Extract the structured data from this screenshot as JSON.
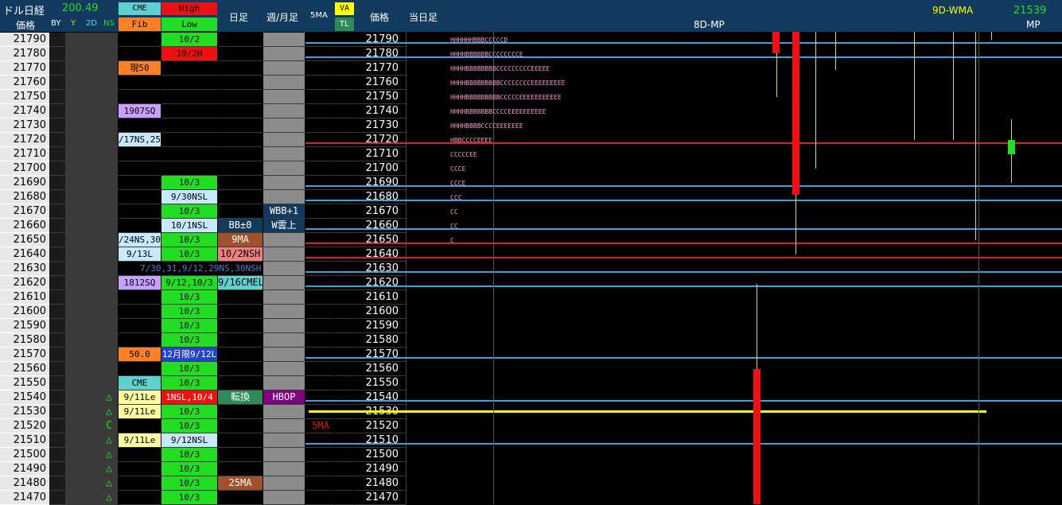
{
  "header": {
    "title": "ドル日経",
    "title_value": "200.49",
    "price_label": "価格",
    "flags": [
      "BY",
      "Y",
      "2D",
      "NS"
    ],
    "cme_label": "CME",
    "fib_label": "Fib",
    "high_label": "High",
    "low_label": "Low",
    "daily_label": "日足",
    "weekly_label": "週/月足",
    "ma5_label": "5MA",
    "va_label": "VA",
    "tl_label": "TL",
    "price2_label": "価格",
    "today_label": "当日足",
    "mp8d_label": "8D-MP",
    "wma_label": "9D-WMA",
    "mp_value": "21539",
    "mp_label": "MP"
  },
  "prices": [
    "21790",
    "21780",
    "21770",
    "21760",
    "21750",
    "21740",
    "21730",
    "21720",
    "21710",
    "21700",
    "21690",
    "21680",
    "21670",
    "21660",
    "21650",
    "21640",
    "21630",
    "21620",
    "21610",
    "21600",
    "21590",
    "21580",
    "21570",
    "21560",
    "21550",
    "21540",
    "21530",
    "21520",
    "21510",
    "21500",
    "21490",
    "21480",
    "21470"
  ],
  "fib_tags": [
    {
      "row": 2,
      "text": "現50",
      "color": "#ff7f27",
      "fg": "#000"
    },
    {
      "row": 5,
      "text": "1907SQ",
      "color": "#c8a0ff",
      "fg": "#000"
    },
    {
      "row": 7,
      "text": "/17NS,25",
      "color": "#c8e8ff",
      "fg": "#000"
    },
    {
      "row": 14,
      "text": "/24NS,30",
      "color": "#c8e8ff",
      "fg": "#000"
    },
    {
      "row": 15,
      "text": "9/13L",
      "color": "#c8e8ff",
      "fg": "#000"
    },
    {
      "row": 17,
      "text": "1812SQ",
      "color": "#c8a0ff",
      "fg": "#000"
    },
    {
      "row": 22,
      "text": "50.0",
      "color": "#ff7f27",
      "fg": "#000"
    },
    {
      "row": 24,
      "text": "CME",
      "color": "#5fd0d0",
      "fg": "#000"
    },
    {
      "row": 25,
      "text": "9/11Le",
      "color": "#ffffa0",
      "fg": "#000"
    },
    {
      "row": 26,
      "text": "9/11Le",
      "color": "#ffffa0",
      "fg": "#000"
    },
    {
      "row": 28,
      "text": "9/11Le",
      "color": "#ffffa0",
      "fg": "#000"
    }
  ],
  "ns_marks": [
    {
      "row": 25,
      "text": "△"
    },
    {
      "row": 26,
      "text": "△"
    },
    {
      "row": 27,
      "text": "C"
    },
    {
      "row": 28,
      "text": "△"
    },
    {
      "row": 29,
      "text": "△"
    },
    {
      "row": 30,
      "text": "△"
    },
    {
      "row": 31,
      "text": "△"
    },
    {
      "row": 32,
      "text": "△"
    }
  ],
  "hilo_tags": [
    {
      "row": 0,
      "text": "10/2",
      "color": "#22dd22",
      "fg": "#000"
    },
    {
      "row": 1,
      "text": "10/2H",
      "color": "#ee1111",
      "fg": "#000"
    },
    {
      "row": 10,
      "text": "10/3",
      "color": "#22dd22",
      "fg": "#000"
    },
    {
      "row": 11,
      "text": "9/30NSL",
      "color": "#c8e8ff",
      "fg": "#000"
    },
    {
      "row": 12,
      "text": "10/3",
      "color": "#22dd22",
      "fg": "#000"
    },
    {
      "row": 13,
      "text": "10/1NSL",
      "color": "#c8e8ff",
      "fg": "#000"
    },
    {
      "row": 14,
      "text": "10/3",
      "color": "#22dd22",
      "fg": "#000"
    },
    {
      "row": 15,
      "text": "10/3",
      "color": "#22dd22",
      "fg": "#000"
    },
    {
      "row": 17,
      "text": "9/12,10/3",
      "color": "#22dd22",
      "fg": "#000"
    },
    {
      "row": 18,
      "text": "10/3",
      "color": "#22dd22",
      "fg": "#000"
    },
    {
      "row": 19,
      "text": "10/3",
      "color": "#22dd22",
      "fg": "#000"
    },
    {
      "row": 20,
      "text": "10/3",
      "color": "#22dd22",
      "fg": "#000"
    },
    {
      "row": 21,
      "text": "10/3",
      "color": "#22dd22",
      "fg": "#000"
    },
    {
      "row": 22,
      "text": "12月限9/12L",
      "color": "#2244cc",
      "fg": "#fff"
    },
    {
      "row": 23,
      "text": "10/3",
      "color": "#22dd22",
      "fg": "#000"
    },
    {
      "row": 24,
      "text": "10/3",
      "color": "#22dd22",
      "fg": "#000"
    },
    {
      "row": 25,
      "text": "1NSL,10/4",
      "color": "#ee1111",
      "fg": "#fff"
    },
    {
      "row": 26,
      "text": "10/3",
      "color": "#22dd22",
      "fg": "#000"
    },
    {
      "row": 27,
      "text": "10/3",
      "color": "#22dd22",
      "fg": "#000"
    },
    {
      "row": 28,
      "text": "9/12NSL",
      "color": "#c8e8ff",
      "fg": "#000"
    },
    {
      "row": 29,
      "text": "10/3",
      "color": "#22dd22",
      "fg": "#000"
    },
    {
      "row": 30,
      "text": "10/3",
      "color": "#22dd22",
      "fg": "#000"
    },
    {
      "row": 31,
      "text": "10/3",
      "color": "#22dd22",
      "fg": "#000"
    },
    {
      "row": 32,
      "text": "10/3",
      "color": "#22dd22",
      "fg": "#000"
    }
  ],
  "daily_tags": [
    {
      "row": 13,
      "text": "BB±0",
      "color": "#123a5e",
      "fg": "#fff"
    },
    {
      "row": 14,
      "text": "9MA",
      "color": "#a0522d",
      "fg": "#fff"
    },
    {
      "row": 15,
      "text": "10/2NSH",
      "color": "#f08080",
      "fg": "#000"
    },
    {
      "row": 17,
      "text": "9/16CMEL",
      "color": "#5fd0d0",
      "fg": "#000"
    },
    {
      "row": 25,
      "text": "転換",
      "color": "#2e8b57",
      "fg": "#fff"
    },
    {
      "row": 31,
      "text": "25MA",
      "color": "#a0522d",
      "fg": "#fff"
    }
  ],
  "weekly_tags": [
    {
      "row": 12,
      "text": "WBB+1",
      "color": "#123a5e",
      "fg": "#fff"
    },
    {
      "row": 13,
      "text": "W雲上",
      "color": "#123a5e",
      "fg": "#fff"
    },
    {
      "row": 25,
      "text": "HBOP",
      "color": "#800080",
      "fg": "#fff"
    }
  ],
  "overflow_text": "7/30,31,9/12,29NS,30NSH",
  "ma5_marker": "5MA",
  "mp_rows": [
    {
      "row": 0,
      "text": "HHHHHHBBBCCCCCD"
    },
    {
      "row": 1,
      "text": "HHHHBBBBBBCCCCCCCCE"
    },
    {
      "row": 2,
      "text": "HHHHBBBBBBBBCCCCCCCCCEEEEE"
    },
    {
      "row": 3,
      "text": "HHHHBBBBBBBBBCCCCCCCCEEEEEEEEE"
    },
    {
      "row": 4,
      "text": "HHHHBBBBBBBBBCCCCCEEEEEEEEEEE"
    },
    {
      "row": 5,
      "text": "HHHHBBBBBBBCCCCEEEEEEEEEE"
    },
    {
      "row": 6,
      "text": "HHHHBBBBCCCCEEEEEEE"
    },
    {
      "row": 7,
      "text": "HBBCCCCEEEE"
    },
    {
      "row": 8,
      "text": "CCCCCEE"
    },
    {
      "row": 9,
      "text": "CCCE"
    },
    {
      "row": 10,
      "text": "CCCE"
    },
    {
      "row": 11,
      "text": "CCC"
    },
    {
      "row": 12,
      "text": "CC"
    },
    {
      "row": 13,
      "text": "CC"
    },
    {
      "row": 14,
      "text": "C"
    }
  ],
  "colors": {
    "header_bg": "#123a5e",
    "high_header": "#ee1111",
    "low_header": "#22dd22",
    "cme_header": "#5fd0d0",
    "fib_header": "#ff7f27",
    "va_header": "#ffff00",
    "tl_header": "#2e8b57",
    "hline_blue": "#3aa0e0",
    "hline_red": "#e02020",
    "hline_yellow": "#ffff00"
  }
}
